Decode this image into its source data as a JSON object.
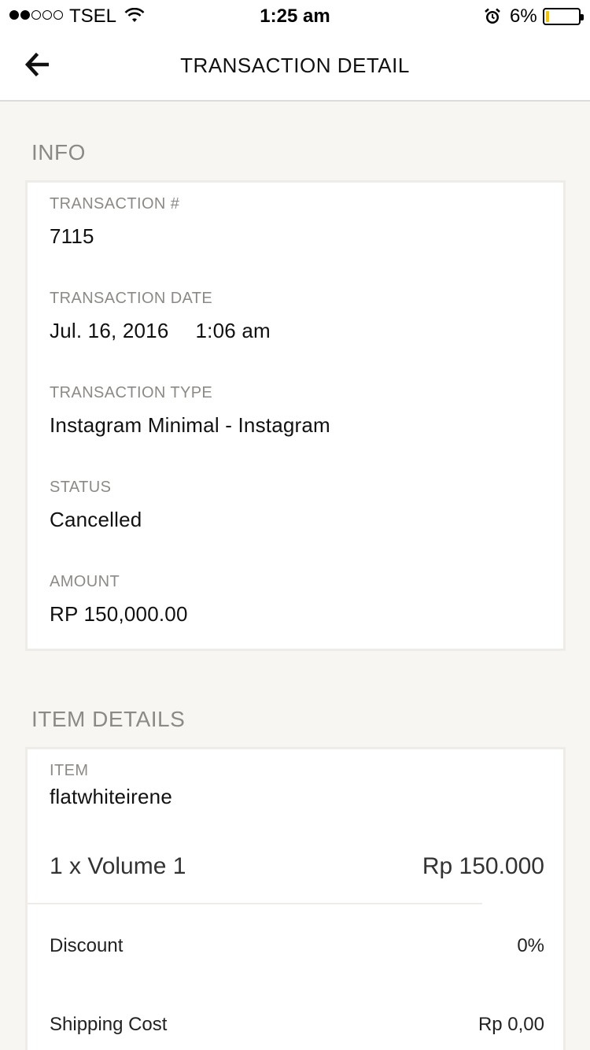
{
  "status_bar": {
    "carrier": "TSEL",
    "time": "1:25 am",
    "battery": "6%",
    "signal_dots": 5,
    "signal_filled": 2
  },
  "header": {
    "title": "TRANSACTION DETAIL",
    "back_icon": "arrow-left-icon"
  },
  "info": {
    "section_title": "INFO",
    "transaction_number": {
      "label": "TRANSACTION #",
      "value": "7115"
    },
    "transaction_date": {
      "label": "TRANSACTION DATE",
      "date": "Jul. 16, 2016",
      "time": "1:06 am"
    },
    "transaction_type": {
      "label": "TRANSACTION TYPE",
      "value": "Instagram Minimal - Instagram"
    },
    "status": {
      "label": "STATUS",
      "value": "Cancelled"
    },
    "amount": {
      "label": "AMOUNT",
      "value": "RP 150,000.00"
    }
  },
  "item_details": {
    "section_title": "ITEM DETAILS",
    "item": {
      "label": "ITEM",
      "value": "flatwhiteirene"
    },
    "line": {
      "description": "1 x Volume 1",
      "price": "Rp 150.000"
    },
    "discount": {
      "label": "Discount",
      "value": "0%"
    },
    "shipping": {
      "label": "Shipping Cost",
      "value": "Rp 0,00"
    }
  },
  "colors": {
    "background": "#f7f6f3",
    "muted_text": "#8d8a85",
    "battery_low": "#f5c400"
  }
}
